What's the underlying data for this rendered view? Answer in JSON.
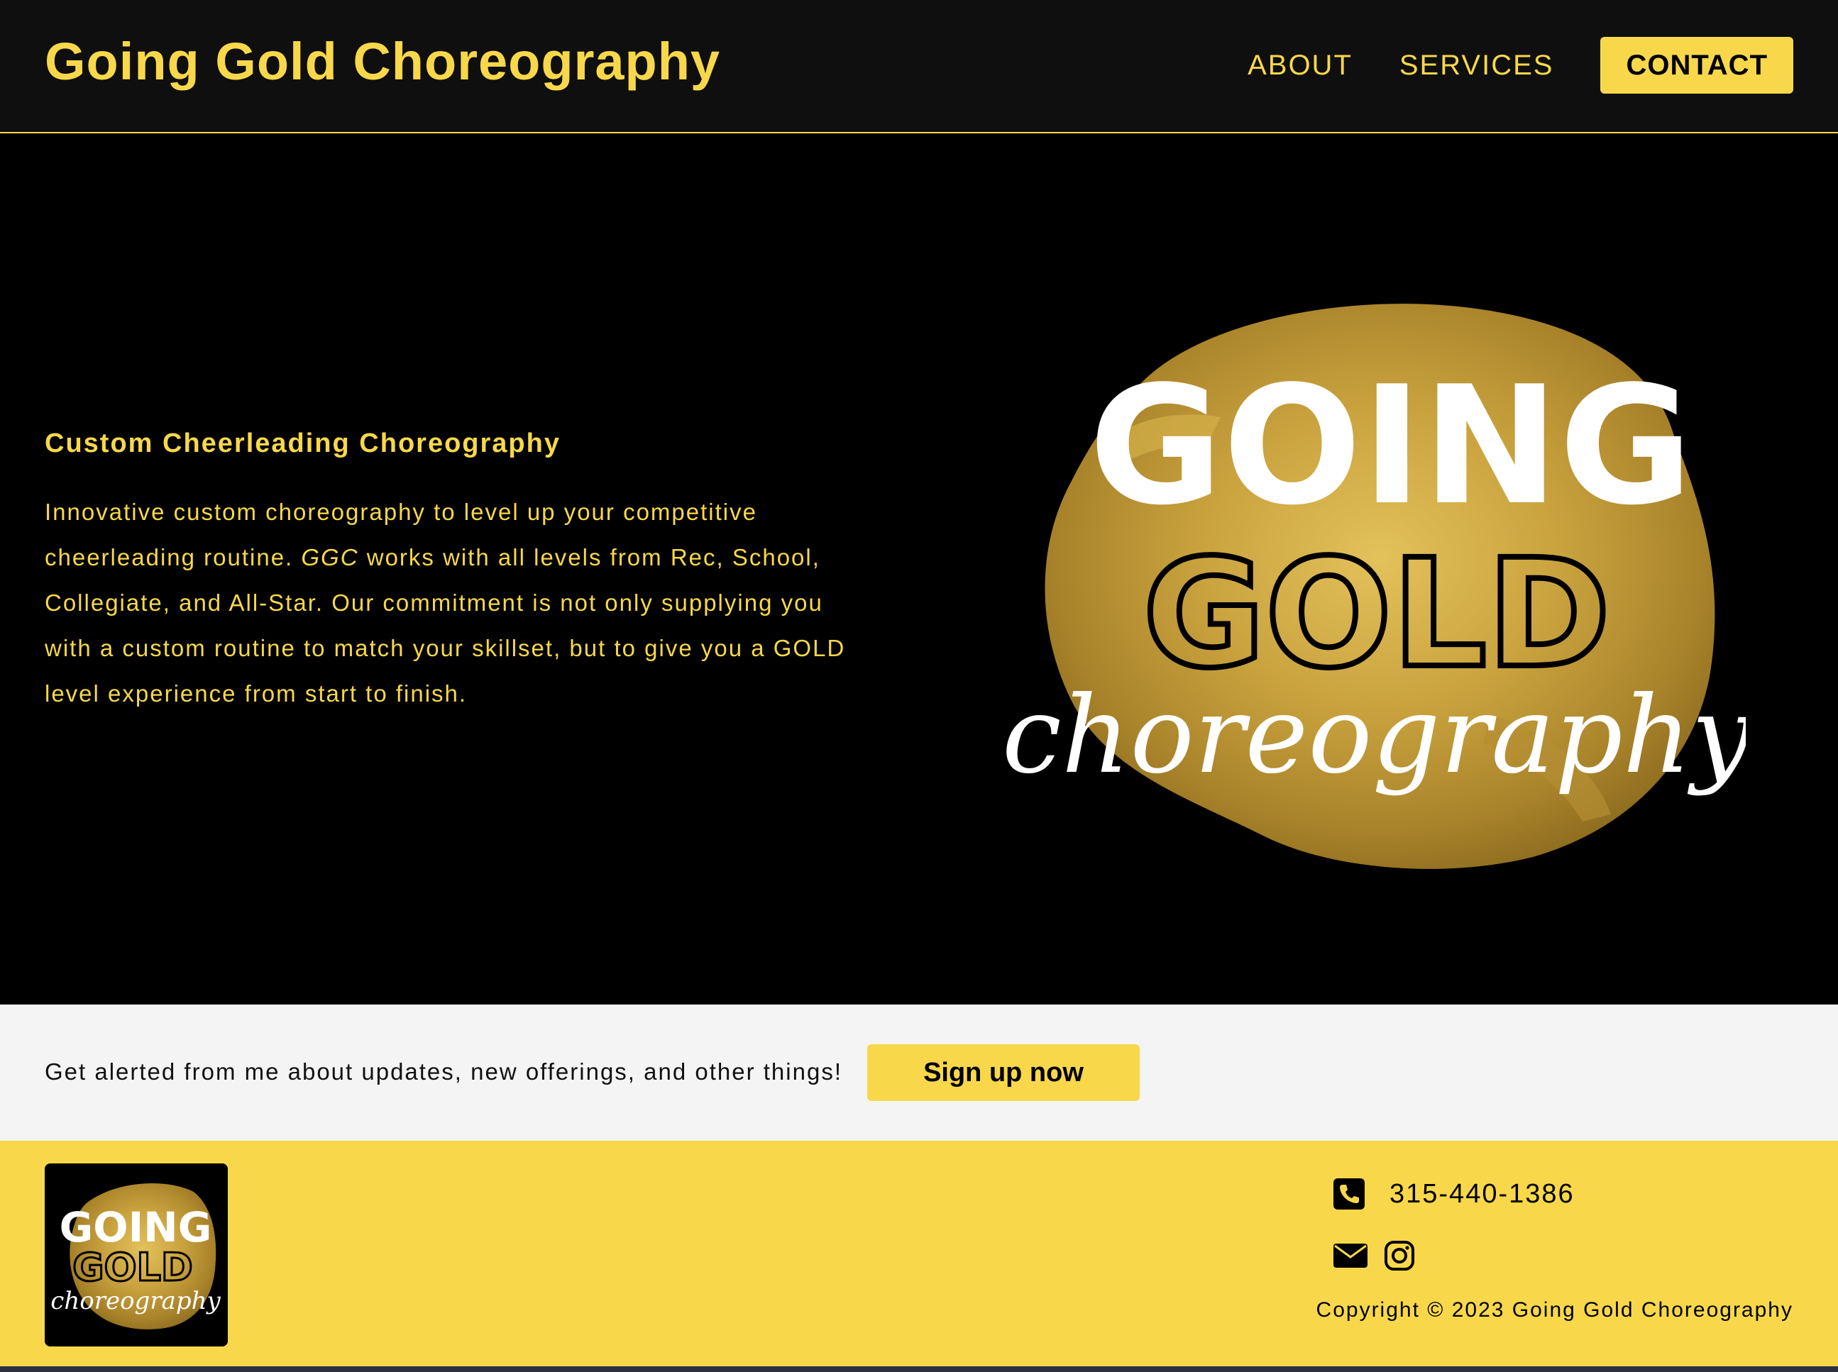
{
  "header": {
    "brand": "Going Gold Choreography",
    "nav": {
      "about": "ABOUT",
      "services": "SERVICES",
      "contact": "CONTACT"
    }
  },
  "hero": {
    "heading": "Custom Cheerleading Choreography",
    "text_before": "Innovative custom choreography to level up your competitive cheerleading routine. ",
    "text_em": "GGC",
    "text_after": " works with all levels from Rec, School, Collegiate, and All-Star. Our commitment is not only supplying you with a custom routine to match your skillset, but to give you a GOLD level experience from start to finish.",
    "logo": {
      "line1": "GOING",
      "line2": "GOLD",
      "line3": "choreography"
    }
  },
  "signup": {
    "text": "Get alerted from me about updates, new offerings, and other things!",
    "button": "Sign up now"
  },
  "footer": {
    "phone": "315-440-1386",
    "copyright": "Copyright © 2023 Going Gold Choreography",
    "icons": [
      "phone-icon",
      "email-icon",
      "instagram-icon"
    ]
  },
  "colors": {
    "gold": "#f8d84a",
    "black": "#000000",
    "header_bg": "#0f0f0f",
    "signup_bg": "#f4f4f4"
  }
}
